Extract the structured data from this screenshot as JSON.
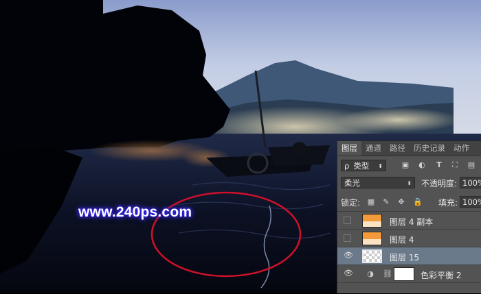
{
  "watermark": "www.240ps.com",
  "panel": {
    "tabs": [
      "图层",
      "通道",
      "路径",
      "历史记录",
      "动作"
    ],
    "active_tab": "图层",
    "filter": {
      "label": "类型",
      "search_glyph": "ρ"
    },
    "blend_mode": "柔光",
    "opacity_label": "不透明度:",
    "opacity_value": "100%",
    "lock_label": "锁定:",
    "fill_label": "填充:",
    "fill_value": "100%",
    "layers": [
      {
        "name": "图层 4 副本",
        "visible": false,
        "thumb": "orange"
      },
      {
        "name": "图层 4",
        "visible": false,
        "thumb": "orange"
      },
      {
        "name": "图层 15",
        "visible": true,
        "thumb": "checker",
        "selected": true
      },
      {
        "name": "色彩平衡 2",
        "visible": true,
        "thumb": "white",
        "adjustment": true
      }
    ]
  },
  "colors": {
    "panel_bg": "#535353",
    "selected_row": "#6b7a8a",
    "annotation": "#d0102a",
    "glow": "#3b2bff"
  },
  "icons": [
    "search-icon",
    "image-filter-icon",
    "adjust-filter-icon",
    "text-filter-icon",
    "shape-filter-icon",
    "smart-filter-icon",
    "lock-pixels-icon",
    "lock-paint-icon",
    "lock-move-icon",
    "lock-all-icon",
    "eye-icon",
    "link-icon",
    "adjustment-icon"
  ]
}
